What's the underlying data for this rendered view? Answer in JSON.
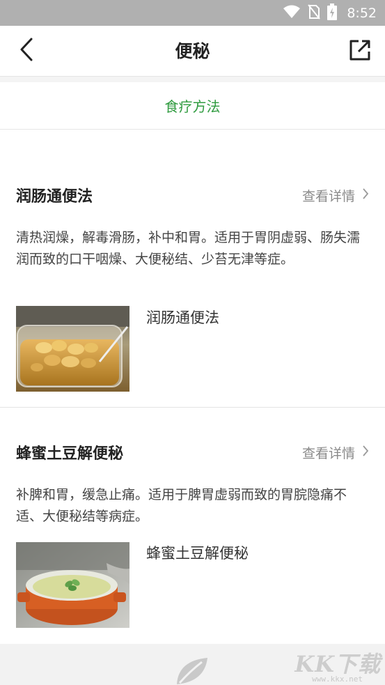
{
  "status_bar": {
    "time": "8:52",
    "icons": [
      "wifi-icon",
      "no-sim-icon",
      "battery-charging-icon"
    ]
  },
  "nav": {
    "title": "便秘",
    "back_icon": "chevron-left-icon",
    "share_icon": "external-link-icon"
  },
  "tab": {
    "label": "食疗方法",
    "color": "#2f9b3f"
  },
  "items": [
    {
      "title": "润肠通便法",
      "more_label": "查看详情",
      "description": "清热润燥，解毒滑肠，补中和胃。适用于胃阴虚弱、肠失濡润而致的口干咽燥、大便秘结、少苔无津等症。",
      "recipe_name": "润肠通便法"
    },
    {
      "title": "蜂蜜土豆解便秘",
      "more_label": "查看详情",
      "description": "补脾和胃，缓急止痛。适用于脾胃虚弱而致的胃脘隐痛不适、大便秘结等病症。",
      "recipe_name": "蜂蜜土豆解便秘"
    }
  ],
  "watermark": {
    "text": "KK下载",
    "url": "www.kkx.net"
  }
}
